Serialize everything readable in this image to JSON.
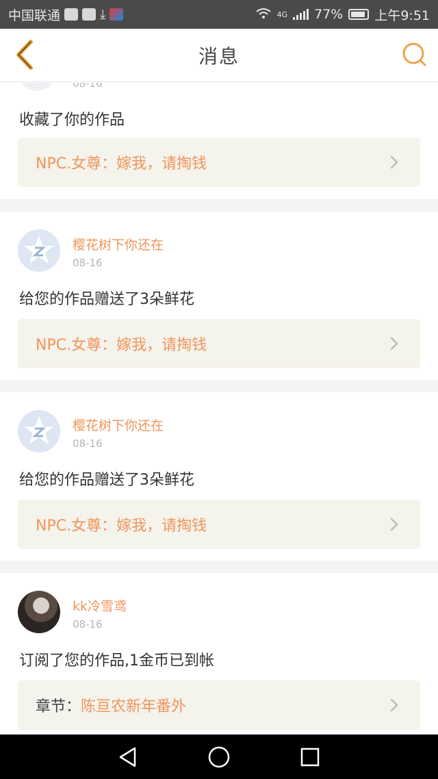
{
  "status_bar": {
    "carrier": "中国联通",
    "network": "4G",
    "battery": "77%",
    "time": "上午9:51"
  },
  "header": {
    "title": "消息",
    "back_icon": "chevron-left-icon",
    "search_icon": "search-icon",
    "accent_color": "#f0a04b"
  },
  "messages": [
    {
      "date": "08-16",
      "text": "收藏了你的作品",
      "work_prefix": "",
      "work_title": "NPC.女尊：嫁我，请掏钱"
    },
    {
      "username": "樱花树下你还在",
      "date": "08-16",
      "text": "给您的作品赠送了3朵鲜花",
      "work_prefix": "",
      "work_title": "NPC.女尊：嫁我，请掏钱"
    },
    {
      "username": "樱花树下你还在",
      "date": "08-16",
      "text": "给您的作品赠送了3朵鲜花",
      "work_prefix": "",
      "work_title": "NPC.女尊：嫁我，请掏钱"
    },
    {
      "username": "kk冷雪鸢",
      "date": "08-16",
      "text": "订阅了您的作品,1金币已到帐",
      "work_prefix": "章节：",
      "work_title": "陈亘农新年番外"
    }
  ],
  "colors": {
    "username": "#f0955a",
    "card_bg": "#f4f3ec",
    "divider": "#f4f4f4"
  }
}
